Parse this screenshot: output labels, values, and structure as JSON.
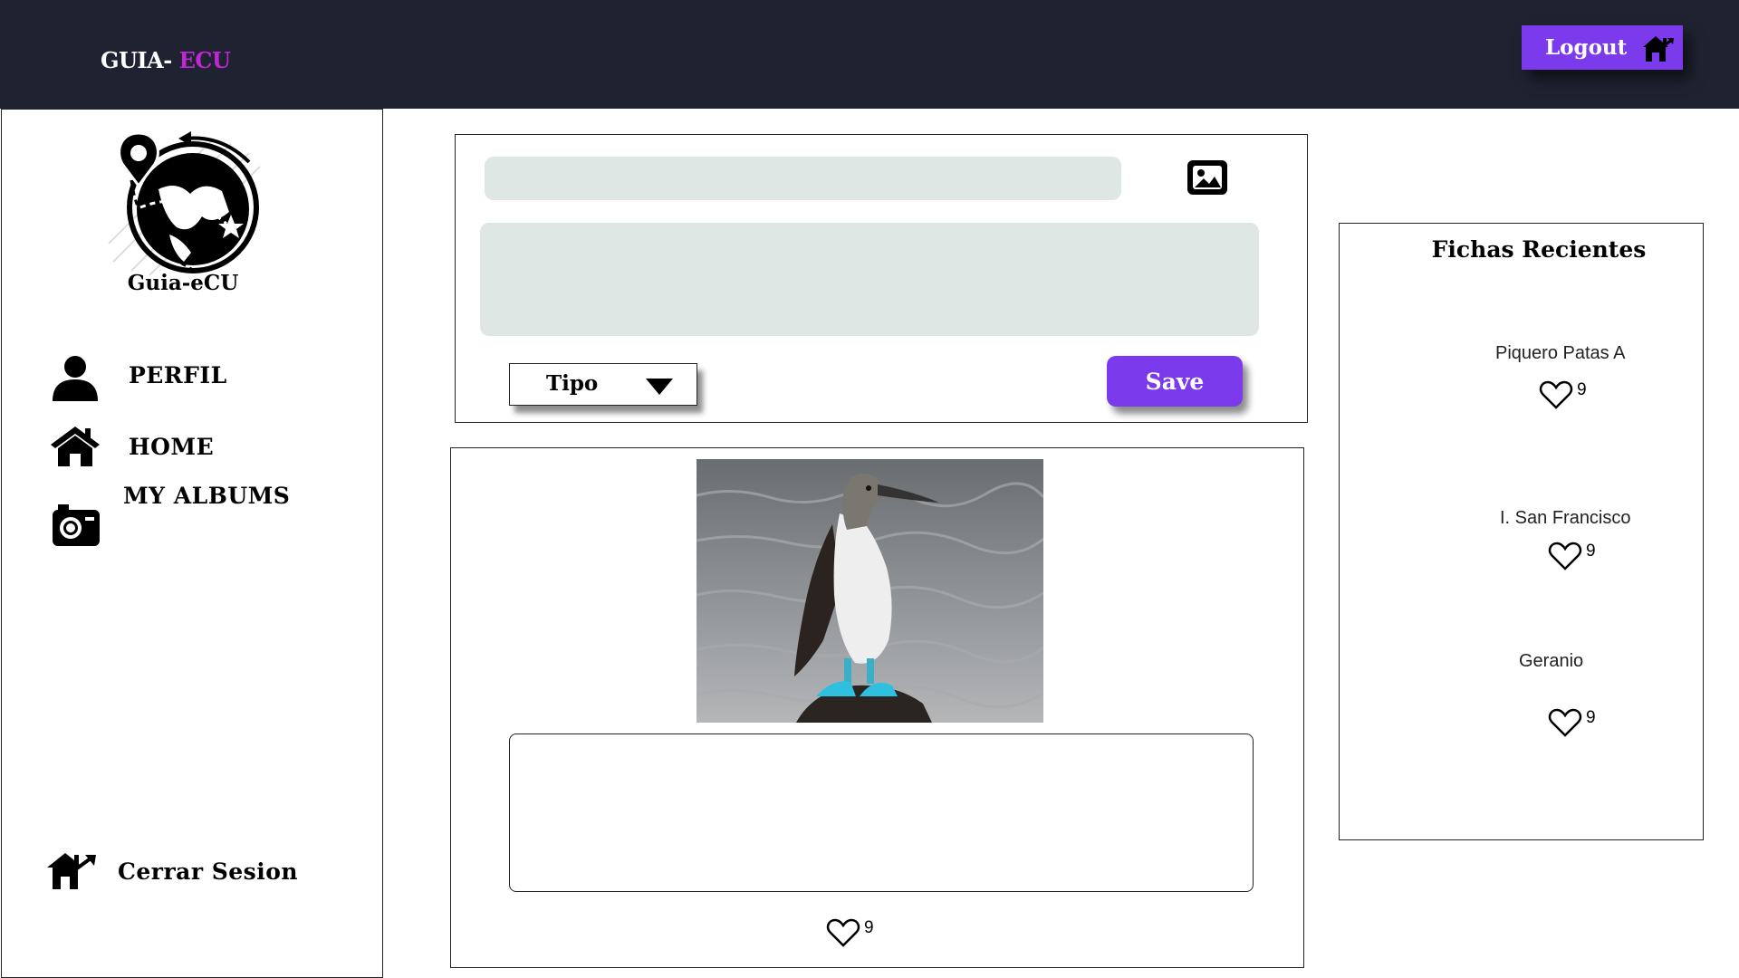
{
  "app": {
    "brand_part1": "GUIA-",
    "brand_part2": "ECU",
    "logout_label": "Logout",
    "colors": {
      "topbar": "#1f2230",
      "accent": "#7c3aed",
      "brand_highlight": "#c026d3",
      "input_bg": "#dfe7e4"
    }
  },
  "sidebar": {
    "logo_name": "Guia-eCU",
    "items": [
      {
        "label": "PERFIL",
        "icon": "user-icon"
      },
      {
        "label": "HOME",
        "icon": "home-icon"
      },
      {
        "label": "MY ALBUMS",
        "icon": "camera-icon"
      }
    ],
    "logout_label": "Cerrar Sesion",
    "logout_icon": "logout-house-icon"
  },
  "composer": {
    "title_value": "",
    "body_value": "",
    "image_icon": "image-icon",
    "type_select": "Tipo",
    "save_label": "Save"
  },
  "post": {
    "photo": "blue-footed-booby-photo",
    "comment_value": "",
    "likes": "9"
  },
  "recent": {
    "title": "Fichas Recientes",
    "items": [
      {
        "name": "Piquero Patas A",
        "likes": "9"
      },
      {
        "name": "I. San Francisco",
        "likes": "9"
      },
      {
        "name": "Geranio",
        "likes": "9"
      }
    ]
  }
}
